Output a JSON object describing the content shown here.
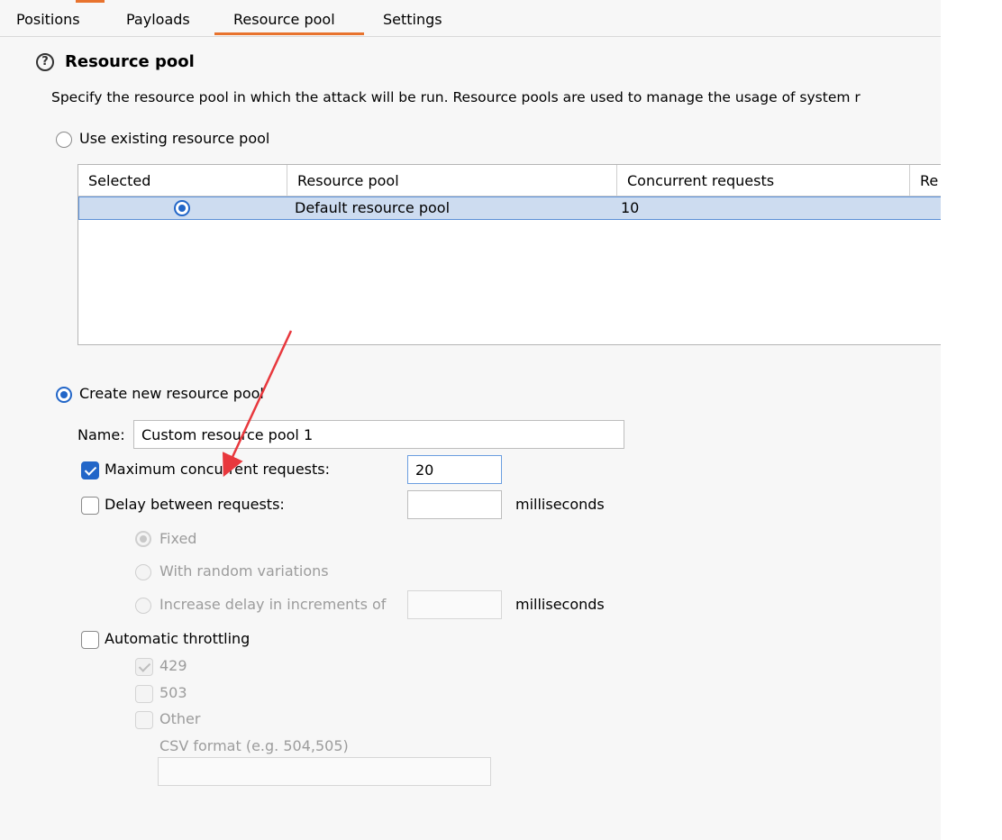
{
  "tabs": [
    {
      "label": "Positions"
    },
    {
      "label": "Payloads"
    },
    {
      "label": "Resource pool"
    },
    {
      "label": "Settings"
    }
  ],
  "section": {
    "title": "Resource pool",
    "description": "Specify the resource pool in which the attack will be run. Resource pools are used to manage the usage of system r"
  },
  "existing": {
    "option_label": "Use existing resource pool",
    "table": {
      "columns": [
        "Selected",
        "Resource pool",
        "Concurrent requests",
        "Re"
      ],
      "rows": [
        {
          "pool": "Default resource pool",
          "concurrent": "10"
        }
      ]
    }
  },
  "create": {
    "option_label": "Create new resource pool",
    "name_label": "Name:",
    "name_value": "Custom resource pool 1",
    "max_concurrent": {
      "label": "Maximum concurrent requests:",
      "value": "20",
      "checked": true
    },
    "delay": {
      "label": "Delay between requests:",
      "value": "",
      "unit": "milliseconds",
      "checked": false
    },
    "delay_modes": {
      "fixed": "Fixed",
      "random": "With random variations",
      "increase": "Increase delay in increments of",
      "increase_value": "",
      "increase_unit": "milliseconds"
    },
    "throttling": {
      "label": "Automatic throttling",
      "checked": false,
      "codes": [
        {
          "label": "429",
          "checked": true
        },
        {
          "label": "503",
          "checked": false
        },
        {
          "label": "Other",
          "checked": false
        }
      ],
      "csv_label": "CSV format (e.g. 504,505)",
      "csv_value": ""
    }
  },
  "colors": {
    "accent": "#e8732e",
    "selection": "#cddcf0",
    "control_blue": "#2266c8",
    "annotation_arrow": "#e8383d"
  }
}
